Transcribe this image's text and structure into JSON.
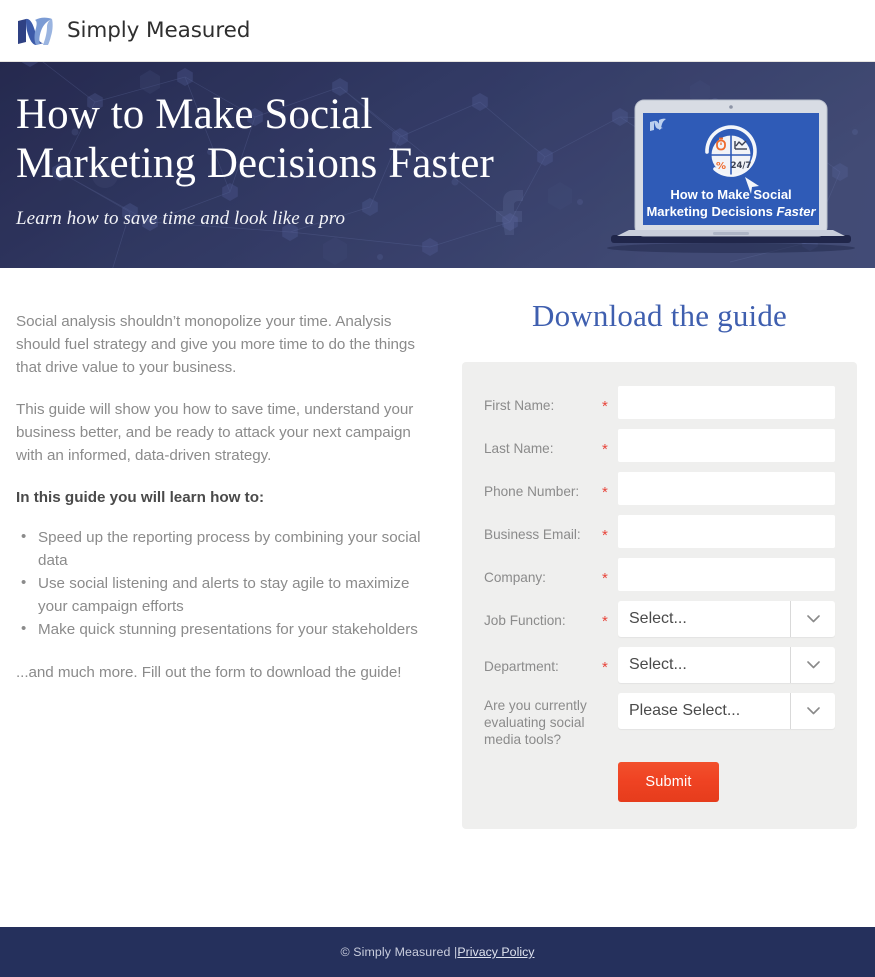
{
  "header": {
    "brand_name": "Simply Measured",
    "logo_icon": "simply-measured-ribbon-logo"
  },
  "hero": {
    "title_line1": "How to Make Social",
    "title_line2": "Marketing Decisions Faster",
    "subtitle": "Learn how to save time and look like a pro",
    "background_color": "#2c3158",
    "laptop": {
      "screen_color": "#2f5bb7",
      "screen_title_line1": "How to Make Social",
      "screen_title_line2_normal": "Marketing Decisions ",
      "screen_title_line2_italic": "Faster",
      "badge_247": "24/7",
      "badge_percent": "%",
      "icons": [
        "stopwatch-icon",
        "line-chart-icon",
        "percent-icon",
        "refresh-arrow-icon"
      ]
    }
  },
  "content": {
    "paragraph1": "Social analysis shouldn’t monopolize your time. Analysis should fuel strategy and give you more time to do the things that drive value to your business.",
    "paragraph2": "This guide will show you how to save time, understand your business better, and be ready to attack your next campaign with an informed, data-driven strategy.",
    "lead_in": "In this guide you will learn how to:",
    "bullets": [
      "Speed up the reporting process by combining your social data",
      "Use social listening and alerts to stay agile to maximize your campaign efforts",
      "Make quick stunning presentations for your stakeholders"
    ],
    "closing": "...and much more. Fill out the form to download the guide!"
  },
  "form": {
    "heading": "Download the guide",
    "heading_color": "#3f5faf",
    "required_marker": "*",
    "fields": [
      {
        "label": "First Name:",
        "type": "text",
        "value": "",
        "placeholder": "",
        "required": true
      },
      {
        "label": "Last Name:",
        "type": "text",
        "value": "",
        "placeholder": "",
        "required": true
      },
      {
        "label": "Phone Number:",
        "type": "text",
        "value": "",
        "placeholder": "",
        "required": true
      },
      {
        "label": "Business Email:",
        "type": "text",
        "value": "",
        "placeholder": "",
        "required": true
      },
      {
        "label": "Company:",
        "type": "text",
        "value": "",
        "placeholder": "",
        "required": true
      },
      {
        "label": "Job Function:",
        "type": "select",
        "value": "Select...",
        "required": true
      },
      {
        "label": "Department:",
        "type": "select",
        "value": "Select...",
        "required": true
      },
      {
        "label": "Are you currently evaluating social media tools?",
        "type": "select",
        "value": "Please Select...",
        "required": false
      }
    ],
    "submit_label": "Submit",
    "submit_color": "#ef4323"
  },
  "footer": {
    "copyright": "© Simply Measured | ",
    "privacy_label": "Privacy Policy",
    "background_color": "#25305c"
  }
}
